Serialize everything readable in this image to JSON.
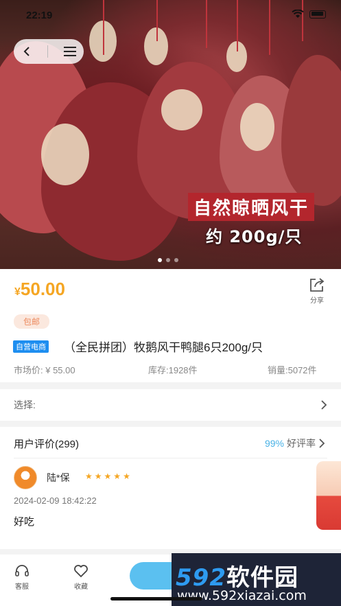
{
  "status_bar": {
    "time": "22:19"
  },
  "hero": {
    "overlay_title": "自然晾晒风干",
    "overlay_sub": "约 200g/只"
  },
  "product": {
    "currency": "¥",
    "price": "50.00",
    "share_label": "分享",
    "shipping_tag": "包邮",
    "self_tag": "自营电商",
    "title": "（全民拼团）牧鹅风干鸭腿6只200g/只",
    "market_price": "市场价: ¥ 55.00",
    "stock": "库存:1928件",
    "sales": "销量:5072件"
  },
  "select_row": {
    "label": "选择:"
  },
  "reviews": {
    "header": "用户评价(299)",
    "good_rate_pct": "99%",
    "good_rate_label": "好评率",
    "items": [
      {
        "user": "陆*保",
        "stars": 5,
        "date": "2024-02-09 18:42:22",
        "text": "好吃"
      }
    ]
  },
  "bottom_bar": {
    "service_label": "客服",
    "favorite_label": "收藏"
  },
  "watermark": {
    "logo_num": "592",
    "logo_text": "软件园",
    "url": "www.592xiazai.com"
  },
  "colors": {
    "price": "#f5a623",
    "accent_blue": "#5bc0f0",
    "self_tag": "#1e8ef0"
  }
}
